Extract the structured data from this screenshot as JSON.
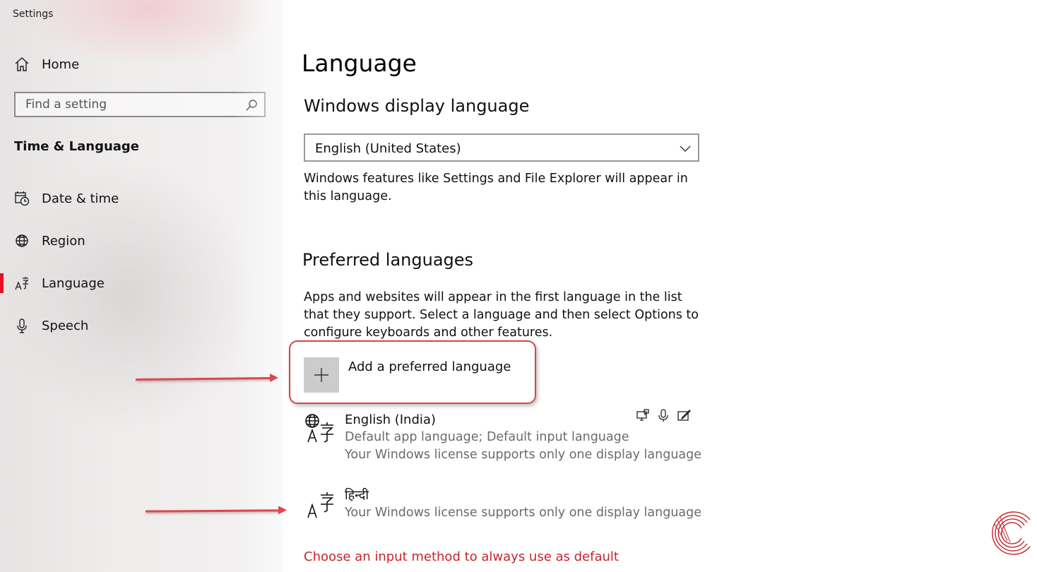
{
  "window": {
    "title": "Settings"
  },
  "sidebar": {
    "home_label": "Home",
    "search": {
      "placeholder": "Find a setting",
      "value": ""
    },
    "section_title": "Time & Language",
    "items": [
      {
        "label": "Date & time",
        "icon": "calendar-clock-icon"
      },
      {
        "label": "Region",
        "icon": "globe-icon"
      },
      {
        "label": "Language",
        "icon": "language-icon",
        "active": true
      },
      {
        "label": "Speech",
        "icon": "microphone-icon"
      }
    ],
    "accent_color": "#e81123"
  },
  "main": {
    "title": "Language",
    "display_language": {
      "heading": "Windows display language",
      "selected": "English (United States)",
      "description": "Windows features like Settings and File Explorer will appear in this language."
    },
    "preferred": {
      "heading": "Preferred languages",
      "description": "Apps and websites will appear in the first language in the list that they support. Select a language and then select Options to configure keyboards and other features.",
      "add_label": "Add a preferred language",
      "languages": [
        {
          "name": "English (India)",
          "line1": "Default app language; Default input language",
          "line2": "Your Windows license supports only one display language",
          "features": [
            "display-speech-icon",
            "microphone-icon",
            "handwriting-icon"
          ]
        },
        {
          "name": "हिन्दी",
          "line1": "Your Windows license supports only one display language"
        }
      ]
    },
    "link_text": "Choose an input method to always use as default",
    "link_color": "#c4262e"
  },
  "annotations": {
    "color": "#e0464c"
  }
}
